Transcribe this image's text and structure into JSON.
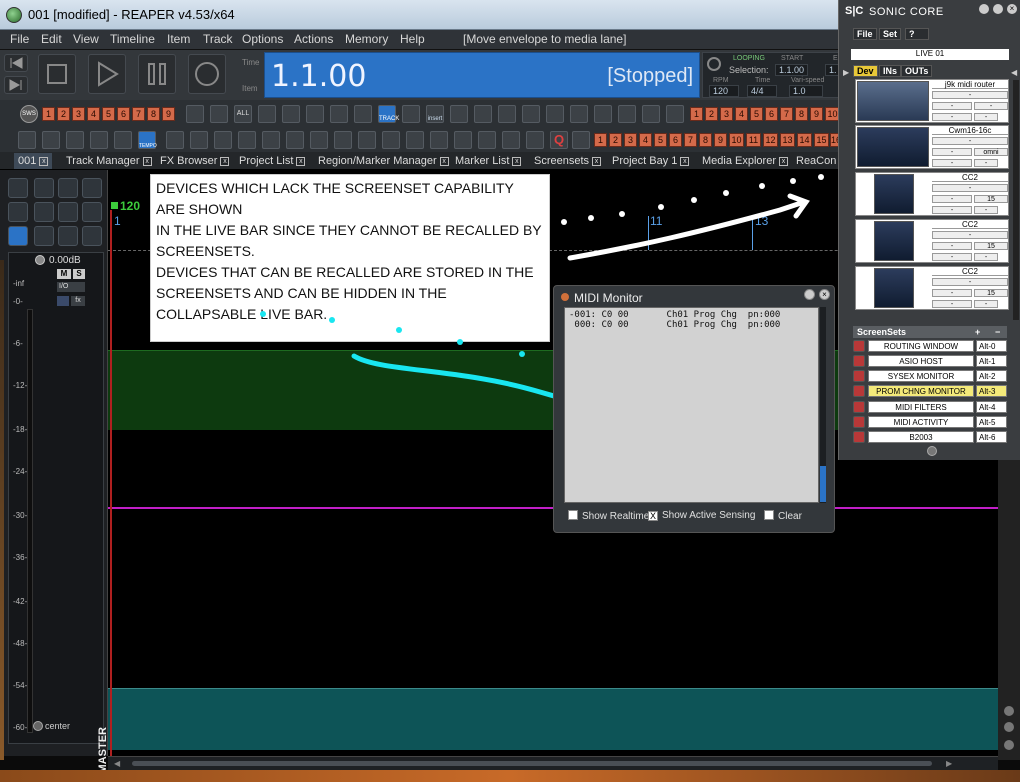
{
  "window": {
    "title": "001 [modified] - REAPER v4.53/x64",
    "minimize": "_",
    "maximize": "□",
    "close": "✕"
  },
  "menu": {
    "items": [
      "File",
      "Edit",
      "View",
      "Timeline",
      "Item",
      "Track",
      "Options",
      "Actions",
      "Memory",
      "Help"
    ],
    "status": "[Move envelope to media lane]"
  },
  "transport": {
    "time": "1.1.00",
    "state": "[Stopped]",
    "labels": {
      "time": "Time",
      "item": "Item"
    },
    "loop": {
      "looping_label": "LOOPING",
      "start_label": "START",
      "e_label": "E",
      "selection_label": "Selection:",
      "selection_value": "1.1.00",
      "selection_tail": "1.",
      "rpm_label": "RPM",
      "bpm": "120",
      "timesig_label": "Time",
      "timesig": "4/4",
      "varispeed_label": "Vari-speed",
      "varispeed": "1.0"
    }
  },
  "toolbar": {
    "top_numbers": [
      "1",
      "2",
      "3",
      "4",
      "5",
      "6",
      "7",
      "8",
      "9"
    ],
    "right_numbers": [
      "1",
      "2",
      "3",
      "4",
      "5",
      "6",
      "7",
      "8",
      "9",
      "10"
    ],
    "bottom_numbers": [
      "1",
      "2",
      "3",
      "4",
      "5",
      "6",
      "7",
      "8",
      "9",
      "10",
      "11",
      "12",
      "13",
      "14",
      "15",
      "16"
    ],
    "all_label": "ALL",
    "track_label": "TRACK",
    "insert_label": "insert",
    "tempo_label": "TEMPO"
  },
  "tabs": [
    {
      "label": "001"
    },
    {
      "label": "Track Manager"
    },
    {
      "label": "FX Browser"
    },
    {
      "label": "Project List"
    },
    {
      "label": "Region/Marker Manager"
    },
    {
      "label": "Marker List"
    },
    {
      "label": "Screensets"
    },
    {
      "label": "Project Bay 1"
    },
    {
      "label": "Media Explorer"
    },
    {
      "label": "ReaCon"
    }
  ],
  "master": {
    "volume": "0.00dB",
    "label": "MASTER",
    "m": "M",
    "s": "S",
    "io": "I/O",
    "fx": "fx",
    "pan": "center",
    "scale": [
      "-inf",
      "-0-",
      "-6-",
      "-12-",
      "-18-",
      "-24-",
      "-30-",
      "-36-",
      "-42-",
      "-48-",
      "-54-",
      "-60-"
    ]
  },
  "ruler": {
    "bpm_marker": "120",
    "bars": [
      "1",
      "11",
      "13"
    ]
  },
  "note": {
    "lines": [
      "DEVICES WHICH LACK THE SCREENSET CAPABILITY ARE SHOWN",
      "IN THE LIVE BAR SINCE THEY CANNOT BE RECALLED BY SCREENSETS.",
      "DEVICES THAT CAN BE RECALLED ARE STORED IN THE SCREENSETS AND CAN BE HIDDEN IN THE COLLAPSABLE LIVE BAR."
    ]
  },
  "midi_monitor": {
    "title": "MIDI Monitor",
    "log": [
      "-001: C0 00       Ch01 Prog Chg  pn:000",
      " 000: C0 00       Ch01 Prog Chg  pn:000"
    ],
    "show_realtime": "Show Realtime",
    "show_active_sensing": "Show Active Sensing",
    "clear": "Clear",
    "active_sensing_checked": "X"
  },
  "sonic_core": {
    "title": "SONIC CORE",
    "logo": "S|C",
    "menu": [
      "File",
      "Set",
      "?"
    ],
    "live_title": "LIVE 01",
    "tabs": [
      "Dev",
      "INs",
      "OUTs"
    ],
    "devices": [
      {
        "name": "j9k midi router",
        "fields": [
          "-",
          "-",
          "-",
          "-",
          "-",
          "-"
        ]
      },
      {
        "name": "Cwm16-16c",
        "fields": [
          "-",
          "-",
          "omni",
          "-",
          "-",
          "-"
        ]
      },
      {
        "name": "CC2",
        "fields": [
          "-",
          "-",
          "15",
          "-",
          "-",
          "-"
        ]
      },
      {
        "name": "CC2",
        "fields": [
          "-",
          "-",
          "15",
          "-",
          "-",
          "-"
        ]
      },
      {
        "name": "CC2",
        "fields": [
          "-",
          "-",
          "15",
          "-",
          "-",
          "-"
        ]
      }
    ],
    "screensets_header": "ScreenSets",
    "screensets_plus": "+",
    "screensets_minus": "−",
    "screensets": [
      {
        "name": "ROUTING WINDOW",
        "key": "Alt-0",
        "active": false
      },
      {
        "name": "ASIO HOST",
        "key": "Alt-1",
        "active": false
      },
      {
        "name": "SYSEX MONITOR",
        "key": "Alt-2",
        "active": false
      },
      {
        "name": "PROM CHNG MONITOR",
        "key": "Alt-3",
        "active": true
      },
      {
        "name": "MIDI FILTERS",
        "key": "Alt-4",
        "active": false
      },
      {
        "name": "MIDI ACTIVITY",
        "key": "Alt-5",
        "active": false
      },
      {
        "name": "B2003",
        "key": "Alt-6",
        "active": false
      }
    ]
  },
  "colors": {
    "accent": "#2b73c6",
    "track_green": "#0d3a0f",
    "envelope_pink": "#c21fc7",
    "track_teal": "#0d5457",
    "annotation_cyan": "#19e6f0",
    "screenset_active": "#f4ea7a"
  }
}
